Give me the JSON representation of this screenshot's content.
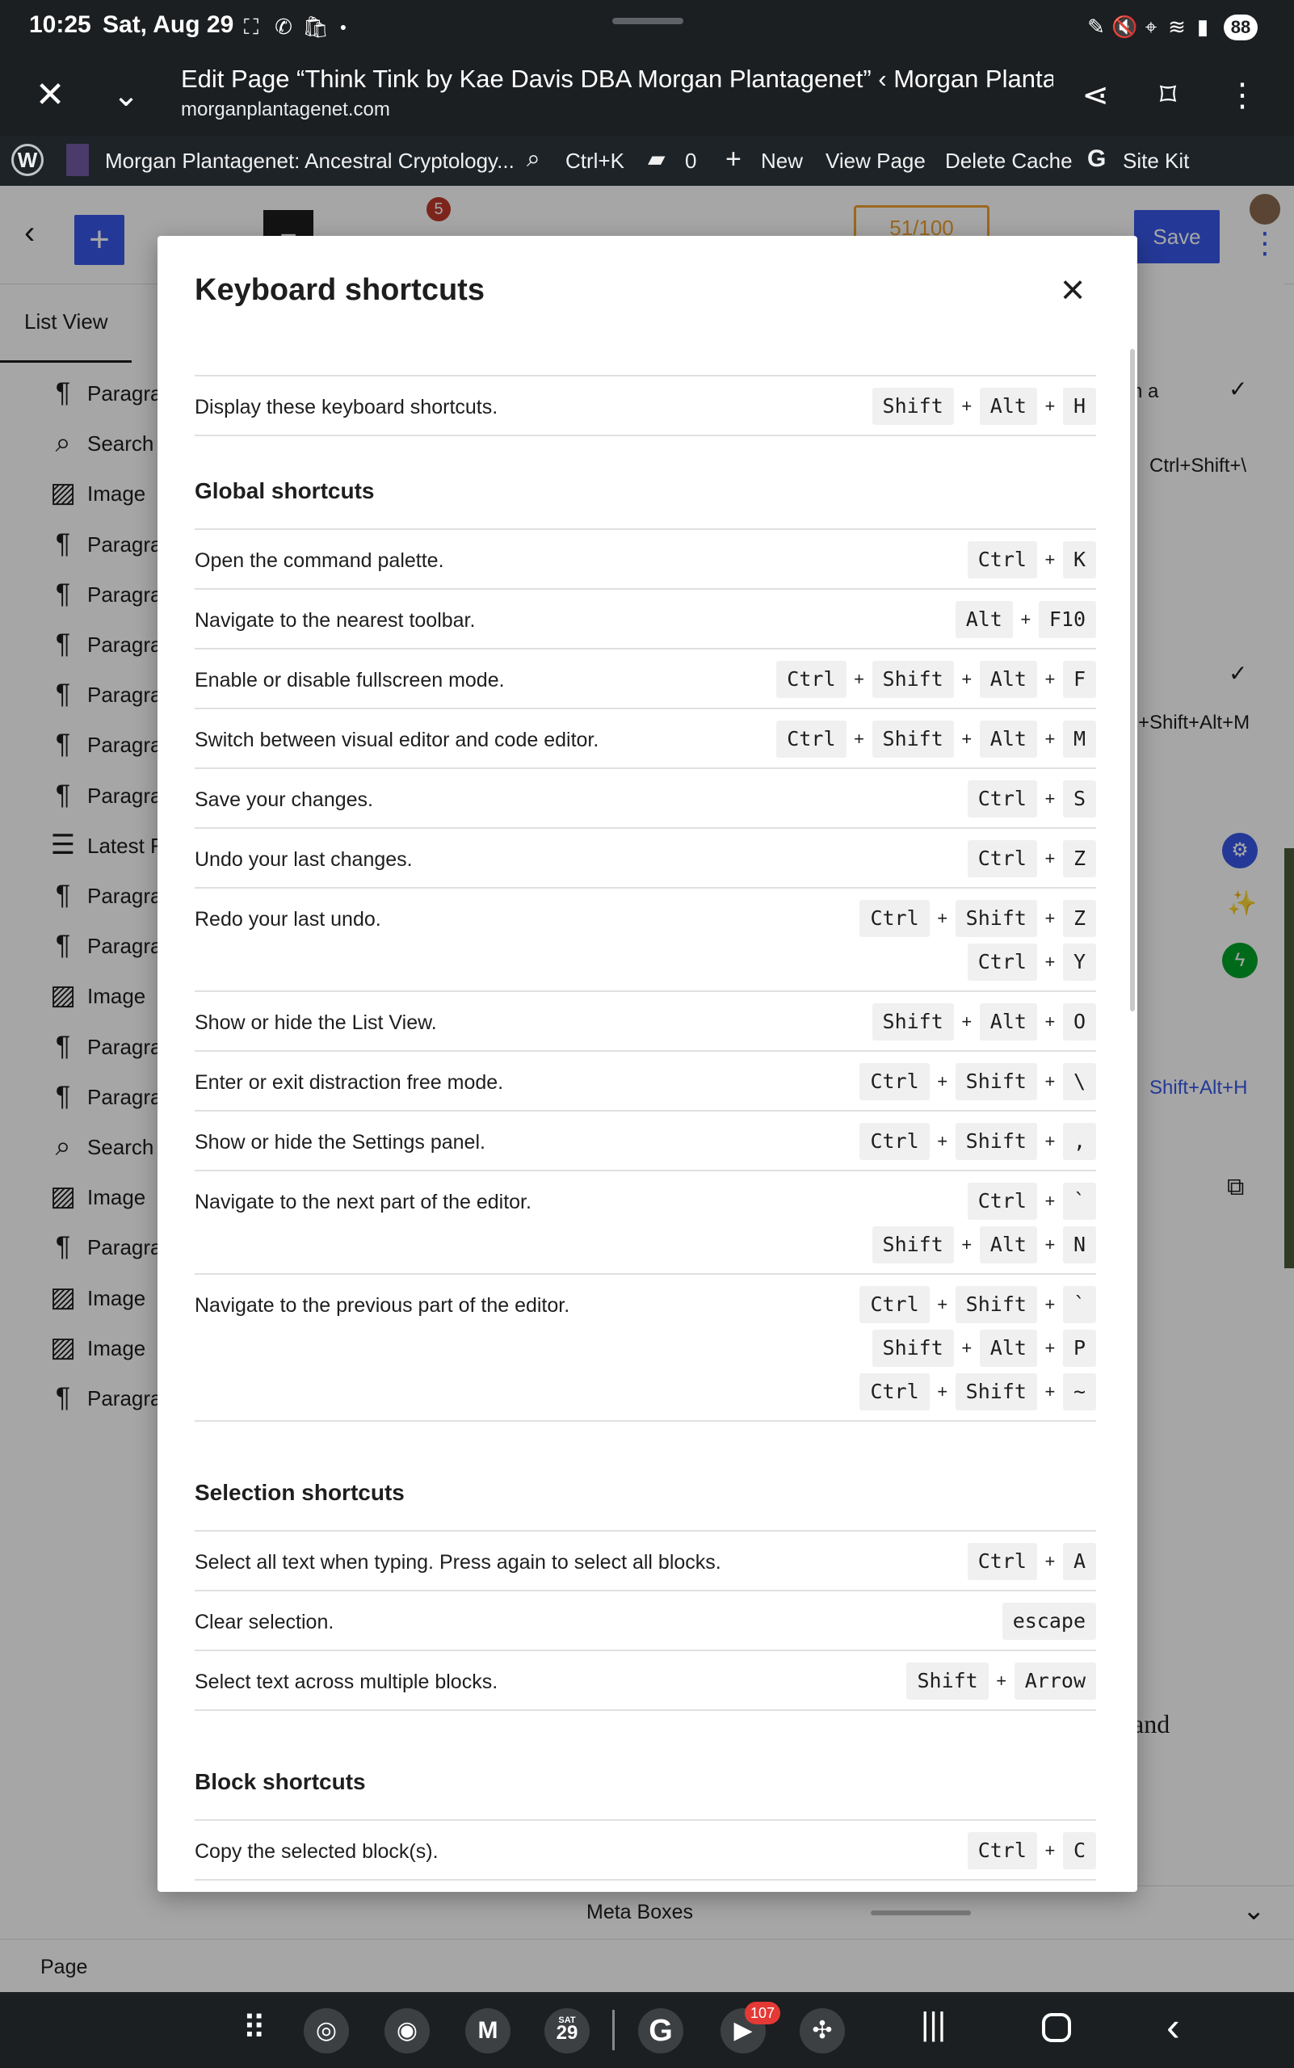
{
  "status_bar": {
    "time": "10:25",
    "date": "Sat, Aug 29",
    "battery": "88"
  },
  "browser": {
    "title": "Edit Page “Think Tink by Kae Davis DBA Morgan Plantagenet” ‹ Morgan Planta...",
    "url": "morganplantagenet.com"
  },
  "admin_bar": {
    "site_name": "Morgan Plantagenet: Ancestral Cryptology...",
    "search_shortcut": "Ctrl+K",
    "comments_count": "0",
    "new_label": "New",
    "view_page": "View Page",
    "delete_cache": "Delete Cache",
    "site_kit": "Site Kit"
  },
  "editor_header": {
    "save_label": "Save",
    "notification_count": "5",
    "score": "51/100"
  },
  "list_view": {
    "tab_label": "List View",
    "items": [
      {
        "icon": "paragraph-icon",
        "label": "Paragra"
      },
      {
        "icon": "search-icon",
        "label": "Search"
      },
      {
        "icon": "image-icon",
        "label": "Image"
      },
      {
        "icon": "paragraph-icon",
        "label": "Paragra"
      },
      {
        "icon": "paragraph-icon",
        "label": "Paragra"
      },
      {
        "icon": "paragraph-icon",
        "label": "Paragra"
      },
      {
        "icon": "paragraph-icon",
        "label": "Paragra"
      },
      {
        "icon": "paragraph-icon",
        "label": "Paragra"
      },
      {
        "icon": "paragraph-icon",
        "label": "Paragra"
      },
      {
        "icon": "latest-posts-icon",
        "label": "Latest F"
      },
      {
        "icon": "paragraph-icon",
        "label": "Paragra"
      },
      {
        "icon": "paragraph-icon",
        "label": "Paragra"
      },
      {
        "icon": "image-icon",
        "label": "Image"
      },
      {
        "icon": "paragraph-icon",
        "label": "Paragra"
      },
      {
        "icon": "paragraph-icon",
        "label": "Paragra"
      },
      {
        "icon": "search-icon",
        "label": "Search"
      },
      {
        "icon": "image-icon",
        "label": "Image"
      },
      {
        "icon": "paragraph-icon",
        "label": "Paragra"
      },
      {
        "icon": "image-icon",
        "label": "Image"
      },
      {
        "icon": "image-icon",
        "label": "Image"
      },
      {
        "icon": "paragraph-icon",
        "label": "Paragra"
      }
    ]
  },
  "right_panel": {
    "text_a": "n a",
    "shortcut1": "Ctrl+Shift+\\",
    "shortcut2": "+Shift+Alt+M",
    "shortcut3": "Shift+Alt+H",
    "content_text": "and"
  },
  "modal": {
    "title": "Keyboard shortcuts",
    "intro": {
      "desc": "Display these keyboard shortcuts.",
      "keys": [
        [
          "Shift",
          "Alt",
          "H"
        ]
      ]
    },
    "sections": [
      {
        "title": "Global shortcuts",
        "rows": [
          {
            "desc": "Open the command palette.",
            "keys": [
              [
                "Ctrl",
                "K"
              ]
            ]
          },
          {
            "desc": "Navigate to the nearest toolbar.",
            "keys": [
              [
                "Alt",
                "F10"
              ]
            ]
          },
          {
            "desc": "Enable or disable fullscreen mode.",
            "keys": [
              [
                "Ctrl",
                "Shift",
                "Alt",
                "F"
              ]
            ]
          },
          {
            "desc": "Switch between visual editor and code editor.",
            "keys": [
              [
                "Ctrl",
                "Shift",
                "Alt",
                "M"
              ]
            ]
          },
          {
            "desc": "Save your changes.",
            "keys": [
              [
                "Ctrl",
                "S"
              ]
            ]
          },
          {
            "desc": "Undo your last changes.",
            "keys": [
              [
                "Ctrl",
                "Z"
              ]
            ]
          },
          {
            "desc": "Redo your last undo.",
            "keys": [
              [
                "Ctrl",
                "Shift",
                "Z"
              ],
              [
                "Ctrl",
                "Y"
              ]
            ]
          },
          {
            "desc": "Show or hide the List View.",
            "keys": [
              [
                "Shift",
                "Alt",
                "O"
              ]
            ]
          },
          {
            "desc": "Enter or exit distraction free mode.",
            "keys": [
              [
                "Ctrl",
                "Shift",
                "\\"
              ]
            ]
          },
          {
            "desc": "Show or hide the Settings panel.",
            "keys": [
              [
                "Ctrl",
                "Shift",
                ","
              ]
            ]
          },
          {
            "desc": "Navigate to the next part of the editor.",
            "keys": [
              [
                "Ctrl",
                "`"
              ],
              [
                "Shift",
                "Alt",
                "N"
              ]
            ]
          },
          {
            "desc": "Navigate to the previous part of the editor.",
            "keys": [
              [
                "Ctrl",
                "Shift",
                "`"
              ],
              [
                "Shift",
                "Alt",
                "P"
              ],
              [
                "Ctrl",
                "Shift",
                "~"
              ]
            ]
          }
        ]
      },
      {
        "title": "Selection shortcuts",
        "rows": [
          {
            "desc": "Select all text when typing. Press again to select all blocks.",
            "keys": [
              [
                "Ctrl",
                "A"
              ]
            ]
          },
          {
            "desc": "Clear selection.",
            "keys": [
              [
                "escape"
              ]
            ]
          },
          {
            "desc": "Select text across multiple blocks.",
            "keys": [
              [
                "Shift",
                "Arrow"
              ]
            ]
          }
        ]
      },
      {
        "title": "Block shortcuts",
        "rows": [
          {
            "desc": "Copy the selected block(s).",
            "keys": [
              [
                "Ctrl",
                "C"
              ]
            ]
          }
        ]
      }
    ]
  },
  "meta_boxes": {
    "label": "Meta Boxes"
  },
  "footer": {
    "label": "Page"
  },
  "nav_bar": {
    "youtube_badge": "107",
    "calendar_day": "29",
    "calendar_weekday": "SAT"
  }
}
